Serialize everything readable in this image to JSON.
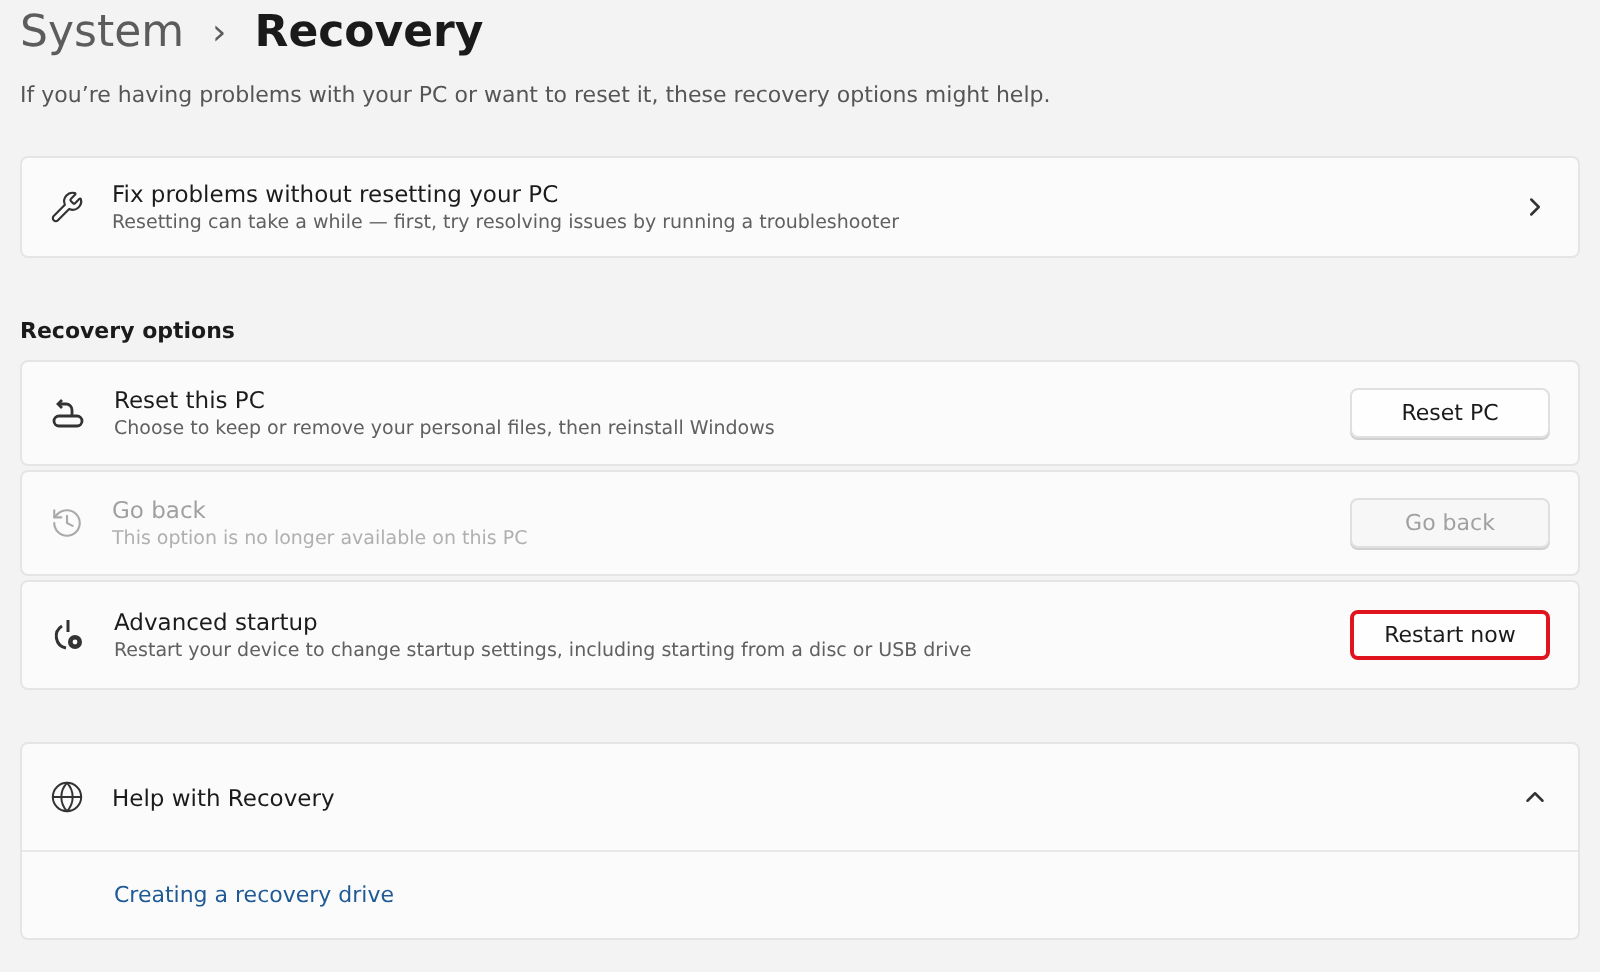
{
  "breadcrumb": {
    "parent": "System",
    "separator": "›",
    "current": "Recovery"
  },
  "description": "If you’re having problems with your PC or want to reset it, these recovery options might help.",
  "fix_card": {
    "title": "Fix problems without resetting your PC",
    "subtitle": "Resetting can take a while — first, try resolving issues by running a troubleshooter"
  },
  "section_title": "Recovery options",
  "options": [
    {
      "kind": "reset",
      "title": "Reset this PC",
      "subtitle": "Choose to keep or remove your personal files, then reinstall Windows",
      "button": "Reset PC",
      "disabled": false,
      "highlighted": false
    },
    {
      "kind": "history",
      "title": "Go back",
      "subtitle": "This option is no longer available on this PC",
      "button": "Go back",
      "disabled": true,
      "highlighted": false
    },
    {
      "kind": "startup",
      "title": "Advanced startup",
      "subtitle": "Restart your device to change startup settings, including starting from a disc or USB drive",
      "button": "Restart now",
      "disabled": false,
      "highlighted": true
    }
  ],
  "help": {
    "title": "Help with Recovery",
    "expanded": true,
    "links": [
      "Creating a recovery drive"
    ]
  }
}
